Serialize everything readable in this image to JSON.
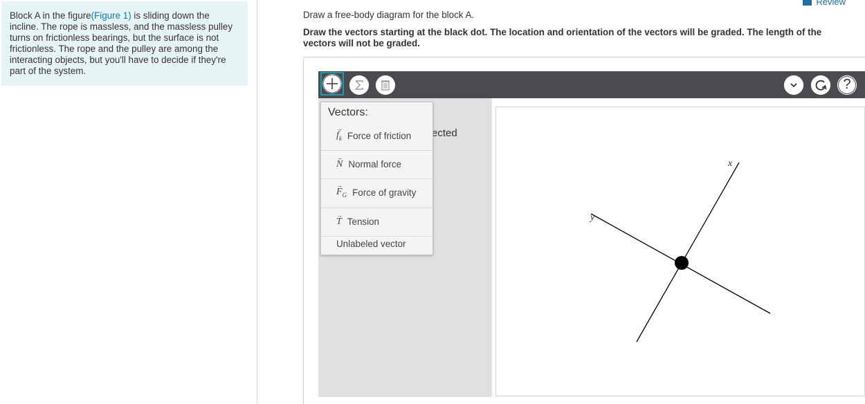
{
  "problem": {
    "text_before_link": "Block A in the figure",
    "link": "(Figure 1)",
    "text_after_link": " is sliding down the incline. The rope is massless, and the massless pulley turns on frictionless bearings, but the surface is not frictionless. The rope and the pulley are among the interacting objects, but you'll have to decide if they're part of the system."
  },
  "header": {
    "review_label": "Review"
  },
  "instructions": {
    "line1": "Draw a free-body diagram for the block A.",
    "line2": "Draw the vectors starting at the black dot. The location and orientation of the vectors will be graded. The length of the vectors will not be graded."
  },
  "toolbar": {
    "add_icon": "plus-icon",
    "sum_icon": "sigma-icon",
    "delete_icon": "trash-icon",
    "dropdown_icon": "chevron-down-icon",
    "reset_icon": "reset-icon",
    "help_label": "?"
  },
  "menu": {
    "title": "Vectors:",
    "items": [
      {
        "symbol": "f",
        "subscript": "k",
        "label": "Force of friction"
      },
      {
        "symbol": "N",
        "subscript": "",
        "label": "Normal force"
      },
      {
        "symbol": "F",
        "subscript": "G",
        "label": "Force of gravity"
      },
      {
        "symbol": "T",
        "subscript": "",
        "label": "Tension"
      },
      {
        "symbol": "",
        "subscript": "",
        "label": "Unlabeled vector"
      }
    ]
  },
  "workspace": {
    "partial_text": "ected"
  },
  "diagram": {
    "x_axis_label": "x",
    "y_axis_label": "y"
  },
  "colors": {
    "accent": "#1a9bb8",
    "toolbar": "#4a4a4f",
    "panel_bg": "#e6f4f6",
    "link": "#0a7ab3"
  }
}
